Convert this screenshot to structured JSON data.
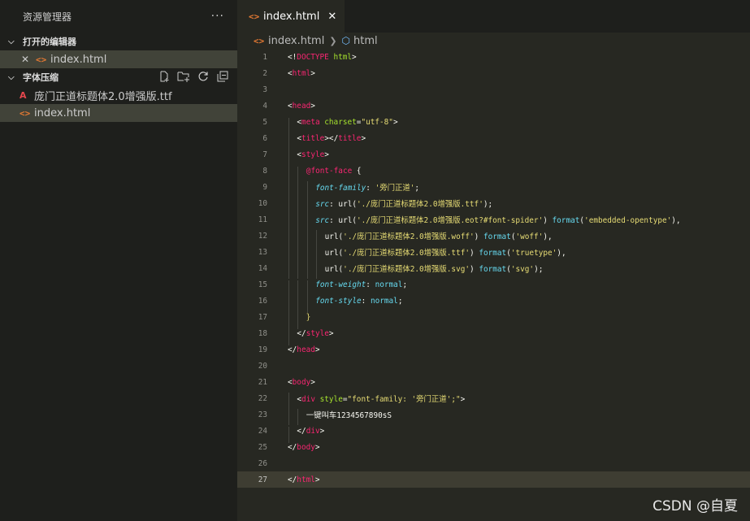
{
  "sidebar": {
    "title": "资源管理器",
    "more": "···",
    "open_editors": {
      "title": "打开的编辑器",
      "items": [
        {
          "close": "✕",
          "name": "index.html"
        }
      ]
    },
    "folder": {
      "title": "字体压缩",
      "files": [
        {
          "name": "庞门正道标题体2.0增强版.ttf",
          "icon": "ttf-font-icon"
        },
        {
          "name": "index.html",
          "icon": "html-file-icon"
        }
      ]
    }
  },
  "tab": {
    "label": "index.html",
    "close": "✕"
  },
  "breadcrumb": {
    "file": "index.html",
    "symbol": "html"
  },
  "code": {
    "current_line": 27,
    "lines": [
      {
        "n": 1,
        "indent": 0,
        "segs": [
          [
            "b",
            "<!"
          ],
          [
            "t",
            "DOCTYPE"
          ],
          [
            "a",
            " html"
          ],
          [
            "b",
            ">"
          ]
        ]
      },
      {
        "n": 2,
        "indent": 0,
        "segs": [
          [
            "b",
            "<"
          ],
          [
            "t",
            "html"
          ],
          [
            "b",
            ">"
          ]
        ]
      },
      {
        "n": 3,
        "indent": 0,
        "segs": []
      },
      {
        "n": 4,
        "indent": 0,
        "segs": [
          [
            "b",
            "<"
          ],
          [
            "t",
            "head"
          ],
          [
            "b",
            ">"
          ]
        ]
      },
      {
        "n": 5,
        "indent": 1,
        "segs": [
          [
            "b",
            "<"
          ],
          [
            "t",
            "meta"
          ],
          [
            "a",
            " charset"
          ],
          [
            "b",
            "="
          ],
          [
            "s",
            "\"utf-8\""
          ],
          [
            "b",
            ">"
          ]
        ]
      },
      {
        "n": 6,
        "indent": 1,
        "segs": [
          [
            "b",
            "<"
          ],
          [
            "t",
            "title"
          ],
          [
            "b",
            "></"
          ],
          [
            "t",
            "title"
          ],
          [
            "b",
            ">"
          ]
        ]
      },
      {
        "n": 7,
        "indent": 1,
        "segs": [
          [
            "b",
            "<"
          ],
          [
            "t",
            "style"
          ],
          [
            "b",
            ">"
          ]
        ]
      },
      {
        "n": 8,
        "indent": 2,
        "segs": [
          [
            "k",
            "@font-face"
          ],
          [
            "b",
            " {"
          ]
        ]
      },
      {
        "n": 9,
        "indent": 3,
        "segs": [
          [
            "p",
            "font-family"
          ],
          [
            "b",
            ": "
          ],
          [
            "s",
            "'旁门正道'"
          ],
          [
            "b",
            ";"
          ]
        ]
      },
      {
        "n": 10,
        "indent": 3,
        "segs": [
          [
            "p",
            "src"
          ],
          [
            "b",
            ": "
          ],
          [
            "b",
            "url("
          ],
          [
            "s",
            "'./庞门正道标题体2.0增强版.ttf'"
          ],
          [
            "b",
            ");"
          ]
        ]
      },
      {
        "n": 11,
        "indent": 3,
        "segs": [
          [
            "p",
            "src"
          ],
          [
            "b",
            ": "
          ],
          [
            "b",
            "url("
          ],
          [
            "s",
            "'./庞门正道标题体2.0增强版.eot?#font-spider'"
          ],
          [
            "b",
            ") "
          ],
          [
            "v",
            "format"
          ],
          [
            "b",
            "("
          ],
          [
            "s",
            "'embedded-opentype'"
          ],
          [
            "b",
            "),"
          ]
        ]
      },
      {
        "n": 12,
        "indent": 4,
        "segs": [
          [
            "b",
            "url("
          ],
          [
            "s",
            "'./庞门正道标题体2.0增强版.woff'"
          ],
          [
            "b",
            ") "
          ],
          [
            "v",
            "format"
          ],
          [
            "b",
            "("
          ],
          [
            "s",
            "'woff'"
          ],
          [
            "b",
            "),"
          ]
        ]
      },
      {
        "n": 13,
        "indent": 4,
        "segs": [
          [
            "b",
            "url("
          ],
          [
            "s",
            "'./庞门正道标题体2.0增强版.ttf'"
          ],
          [
            "b",
            ") "
          ],
          [
            "v",
            "format"
          ],
          [
            "b",
            "("
          ],
          [
            "s",
            "'truetype'"
          ],
          [
            "b",
            "),"
          ]
        ]
      },
      {
        "n": 14,
        "indent": 4,
        "segs": [
          [
            "b",
            "url("
          ],
          [
            "s",
            "'./庞门正道标题体2.0增强版.svg'"
          ],
          [
            "b",
            ") "
          ],
          [
            "v",
            "format"
          ],
          [
            "b",
            "("
          ],
          [
            "s",
            "'svg'"
          ],
          [
            "b",
            ");"
          ]
        ]
      },
      {
        "n": 15,
        "indent": 3,
        "segs": [
          [
            "p",
            "font-weight"
          ],
          [
            "b",
            ": "
          ],
          [
            "v",
            "normal"
          ],
          [
            "b",
            ";"
          ]
        ]
      },
      {
        "n": 16,
        "indent": 3,
        "segs": [
          [
            "p",
            "font-style"
          ],
          [
            "b",
            ": "
          ],
          [
            "v",
            "normal"
          ],
          [
            "b",
            ";"
          ]
        ]
      },
      {
        "n": 17,
        "indent": 2,
        "segs": [
          [
            "s",
            "}"
          ]
        ]
      },
      {
        "n": 18,
        "indent": 1,
        "segs": [
          [
            "b",
            "</"
          ],
          [
            "t",
            "style"
          ],
          [
            "b",
            ">"
          ]
        ]
      },
      {
        "n": 19,
        "indent": 0,
        "segs": [
          [
            "b",
            "</"
          ],
          [
            "t",
            "head"
          ],
          [
            "b",
            ">"
          ]
        ]
      },
      {
        "n": 20,
        "indent": 0,
        "segs": []
      },
      {
        "n": 21,
        "indent": 0,
        "segs": [
          [
            "b",
            "<"
          ],
          [
            "t",
            "body"
          ],
          [
            "b",
            ">"
          ]
        ]
      },
      {
        "n": 22,
        "indent": 1,
        "segs": [
          [
            "b",
            "<"
          ],
          [
            "t",
            "div"
          ],
          [
            "a",
            " style"
          ],
          [
            "b",
            "="
          ],
          [
            "s",
            "\"font-family: '旁门正道';\""
          ],
          [
            "b",
            ">"
          ]
        ]
      },
      {
        "n": 23,
        "indent": 2,
        "segs": [
          [
            "b",
            "一键叫车1234567890sS"
          ]
        ]
      },
      {
        "n": 24,
        "indent": 1,
        "segs": [
          [
            "b",
            "</"
          ],
          [
            "t",
            "div"
          ],
          [
            "b",
            ">"
          ]
        ]
      },
      {
        "n": 25,
        "indent": 0,
        "segs": [
          [
            "b",
            "</"
          ],
          [
            "t",
            "body"
          ],
          [
            "b",
            ">"
          ]
        ]
      },
      {
        "n": 26,
        "indent": 0,
        "segs": []
      },
      {
        "n": 27,
        "indent": 0,
        "segs": [
          [
            "b",
            "</"
          ],
          [
            "t",
            "html"
          ],
          [
            "b",
            ">"
          ]
        ]
      }
    ]
  },
  "watermark": "CSDN @自夏",
  "colors": {
    "editor_bg": "#272822",
    "sidebar_bg": "#1e1f1c",
    "selection": "#414339",
    "tag": "#f92672",
    "attr": "#a6e22e",
    "string": "#e6db74",
    "property": "#66d9ef"
  }
}
